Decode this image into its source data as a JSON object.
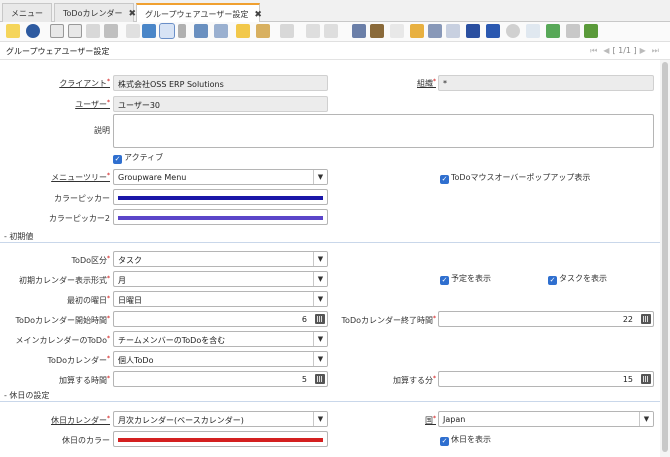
{
  "tabs": [
    {
      "label": "メニュー",
      "closable": false
    },
    {
      "label": "ToDoカレンダー",
      "closable": true
    },
    {
      "label": "グループウェアユーザー設定",
      "closable": true
    }
  ],
  "close_glyph": "✖",
  "page_title": "グループウェアユーザー設定",
  "pager": {
    "first": "⏮",
    "prev": "◀",
    "record": "[ 1/1 ]",
    "next": "▶",
    "last": "⏭"
  },
  "required_mark": "*",
  "check_glyph": "✓",
  "dropdown_glyph": "▼",
  "fields": {
    "client": {
      "label": "クライアント",
      "value": "株式会社OSS ERP Solutions"
    },
    "org": {
      "label": "組織",
      "value": "*"
    },
    "user": {
      "label": "ユーザー",
      "value": "ユーザー30"
    },
    "description": {
      "label": "説明",
      "value": ""
    },
    "active": {
      "label": "アクティブ"
    },
    "menu_tree": {
      "label": "メニューツリー",
      "value": "Groupware Menu"
    },
    "todo_popup": {
      "label": "ToDoマウスオーバーポップアップ表示"
    },
    "color_picker": {
      "label": "カラーピッカー",
      "color": "#1a16a8"
    },
    "color_picker2": {
      "label": "カラーピッカー2",
      "color": "#5b45c9"
    }
  },
  "sections": {
    "initial": "- 初期値",
    "holiday": "- 休日の設定"
  },
  "initial": {
    "todo_type": {
      "label": "ToDo区分",
      "value": "タスク"
    },
    "calendar_view": {
      "label": "初期カレンダー表示形式",
      "value": "月"
    },
    "show_schedule": {
      "label": "予定を表示"
    },
    "show_task": {
      "label": "タスクを表示"
    },
    "first_day": {
      "label": "最初の曜日",
      "value": "日曜日"
    },
    "start_time": {
      "label": "ToDoカレンダー開始時間",
      "value": "6"
    },
    "end_time": {
      "label": "ToDoカレンダー終了時間",
      "value": "22"
    },
    "main_calendar": {
      "label": "メインカレンダーのToDo",
      "value": "チームメンバーのToDoを含む"
    },
    "todo_calendar": {
      "label": "ToDoカレンダー",
      "value": "個人ToDo"
    },
    "add_hours": {
      "label": "加算する時間",
      "value": "5"
    },
    "add_minutes": {
      "label": "加算する分",
      "value": "15"
    }
  },
  "holiday": {
    "calendar": {
      "label": "休日カレンダー",
      "value": "月次カレンダー(ベースカレンダー)"
    },
    "country": {
      "label": "国",
      "value": "Japan"
    },
    "color": {
      "label": "休日のカラー",
      "color": "#d42020"
    },
    "show_holiday": {
      "label": "休日を表示"
    }
  },
  "toolbar_icons": [
    "undo-icon",
    "help-icon",
    "new-record-icon",
    "copy-record-icon",
    "delete-icon",
    "save-icon",
    "refresh-icon",
    "find-icon",
    "attachment-icon",
    "chat-icon",
    "archive-icon",
    "history-icon",
    "grid-toggle-icon",
    "parent-icon",
    "detail-icon",
    "first-record-icon",
    "previous-record-icon",
    "next-record-icon",
    "last-record-icon",
    "report-icon",
    "archived-documents-icon",
    "print-icon",
    "lock-icon",
    "zoom-across-icon",
    "request-icon",
    "product-info-icon",
    "active-workflows-icon",
    "workflow-icon",
    "export-icon",
    "customize-icon",
    "end-window-icon"
  ]
}
